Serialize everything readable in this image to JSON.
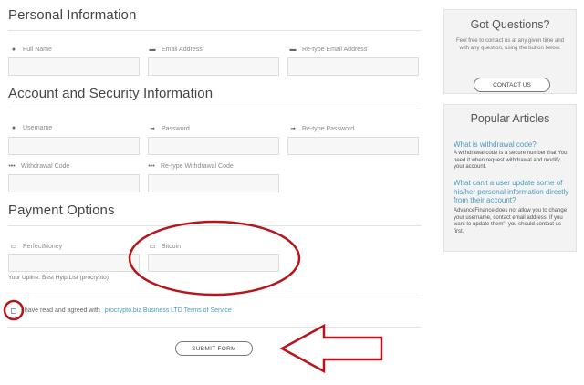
{
  "personal": {
    "title": "Personal Information",
    "full_name_label": "Full Name",
    "email_label": "Email Address",
    "retype_email_label": "Re-type Email Address"
  },
  "account": {
    "title": "Account and Security Information",
    "username_label": "Username",
    "password_label": "Password",
    "retype_password_label": "Re-type Password",
    "withdrawal_code_label": "Withdrawal Code",
    "retype_withdrawal_code_label": "Re-type Withdrawal Code"
  },
  "payment": {
    "title": "Payment Options",
    "perfectmoney_label": "PerfectMoney",
    "bitcoin_label": "Bitcoin",
    "upline_note": "Your Upline: Best Hyip List (procrypto)"
  },
  "terms": {
    "prefix": "I have read and agreed with",
    "link": "procrypto.biz Business LTD Terms of Service"
  },
  "submit_label": "SUBMIT FORM",
  "questions_panel": {
    "title": "Got Questions?",
    "text": "Feel free to contact us at any given time and with any question, using the button below.",
    "button": "CONTACT US"
  },
  "articles_panel": {
    "title": "Popular Articles",
    "items": [
      {
        "question": "What is withdrawal code?",
        "answer": "A withdrawal code is a secure number that You need it when request withdrawal and modify your account."
      },
      {
        "question": "What can't a user update some of his/her personal information directly from their account?",
        "answer": "AdvanceFinance does not allow you to change your username, contact email address. If you want to update them\", you should contact us first."
      }
    ]
  },
  "colors": {
    "link": "#4a9bbf",
    "annotation": "#b5151d",
    "input_bg": "#f7f7f7",
    "panel_bg": "#f3f3f3"
  }
}
